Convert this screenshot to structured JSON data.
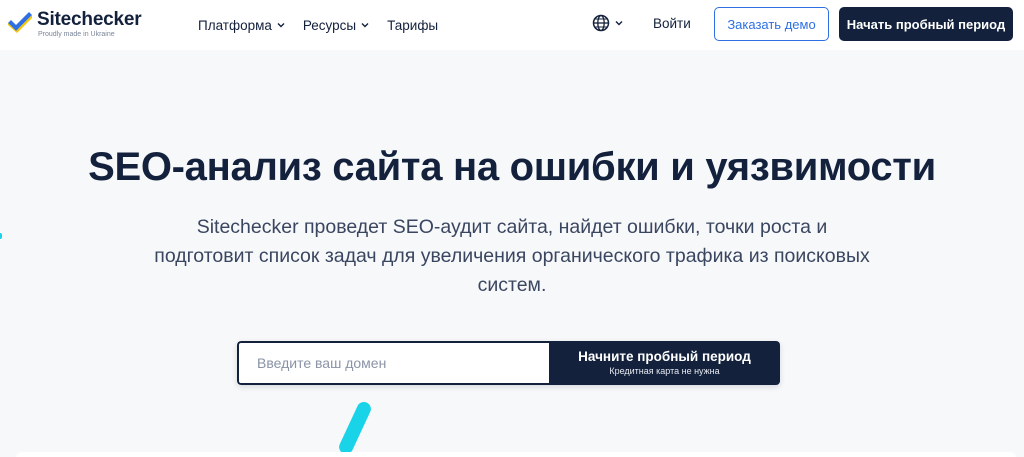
{
  "brand": {
    "name": "Sitechecker",
    "tagline": "Proudly made in Ukraine",
    "colors": {
      "flag_blue": "#2e6fe4",
      "flag_yellow": "#f7c500"
    }
  },
  "nav": {
    "items": [
      {
        "label": "Платформа",
        "has_dropdown": true
      },
      {
        "label": "Ресурсы",
        "has_dropdown": true
      },
      {
        "label": "Тарифы",
        "has_dropdown": false
      }
    ],
    "language_icon": "globe-icon",
    "login_label": "Войти",
    "demo_label": "Заказать демо",
    "trial_label": "Начать пробный период"
  },
  "hero": {
    "title": "SEO-анализ сайта на ошибки и уязвимости",
    "subtitle": "Sitechecker проведет SEO-аудит сайта, найдет ошибки, точки роста и подготовит список задач для увеличения органического трафика из поисковых систем."
  },
  "form": {
    "domain_placeholder": "Введите ваш домен",
    "domain_value": "",
    "submit_label": "Начните пробный период",
    "submit_note": "Кредитная карта не нужна"
  },
  "colors": {
    "primary_dark": "#13213c",
    "accent_blue": "#2e6fe4",
    "accent_cyan": "#19d3e8",
    "background": "#f7f8fa"
  }
}
